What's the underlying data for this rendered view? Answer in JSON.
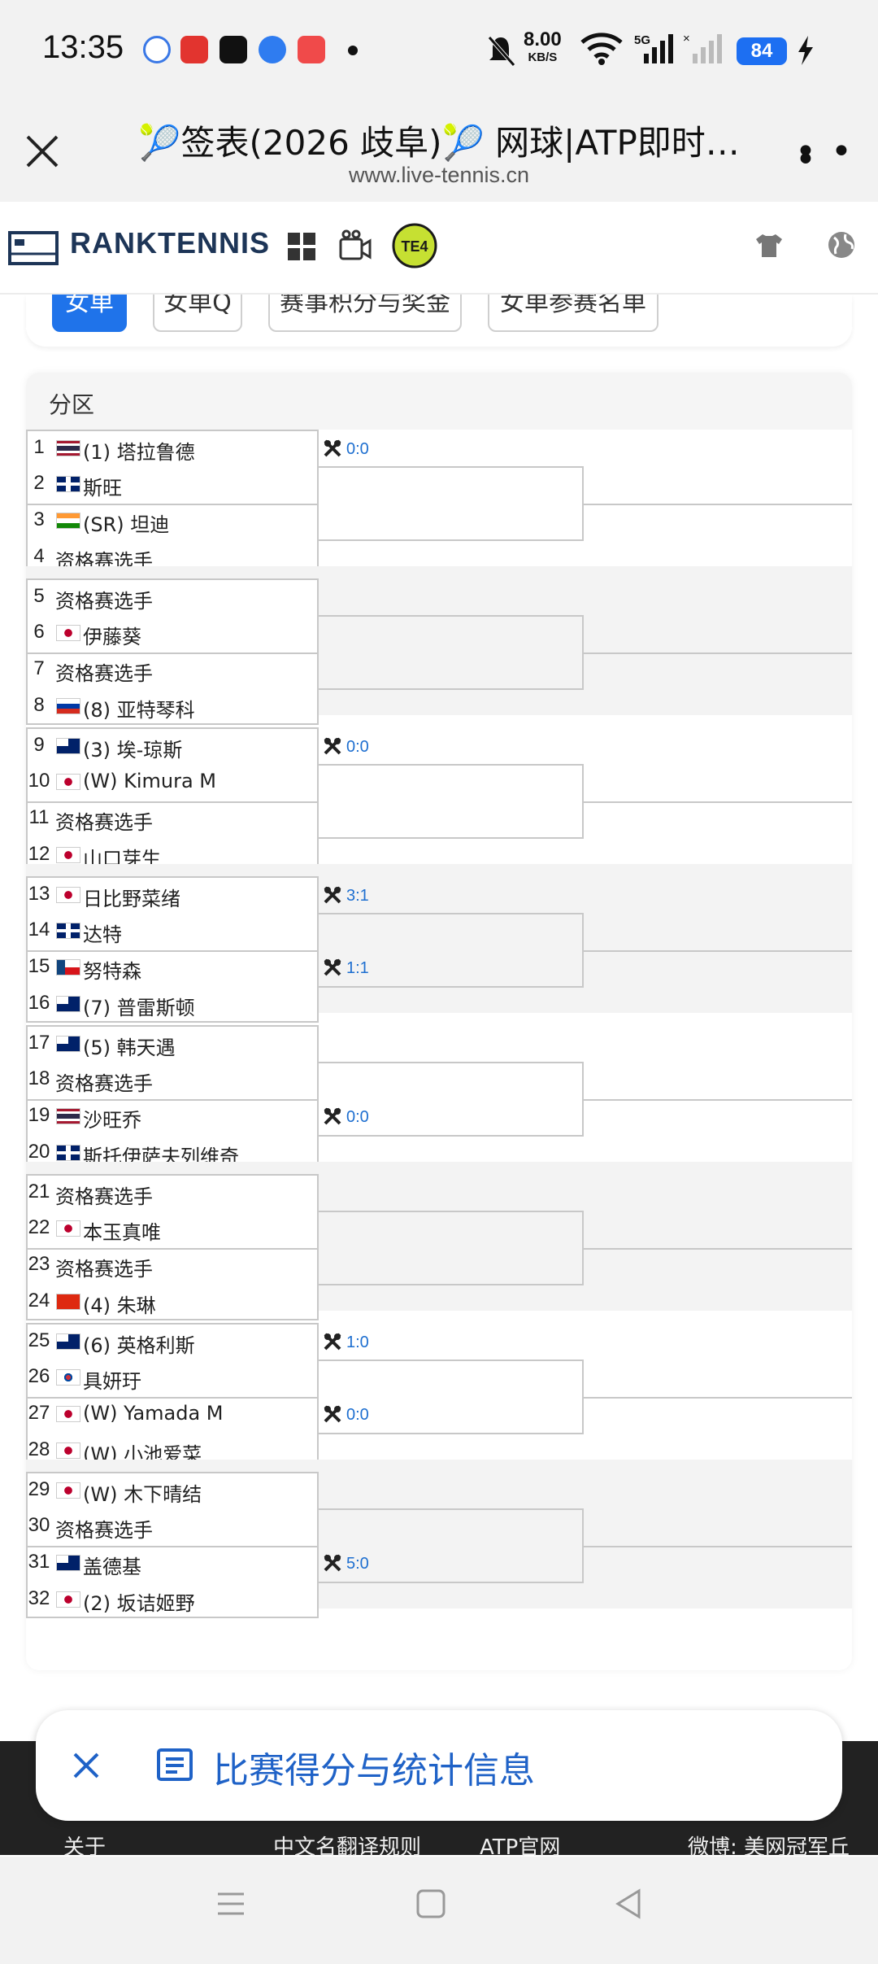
{
  "status": {
    "time": "13:35",
    "net_speed": "8.00",
    "net_unit": "KB/S",
    "battery": "84",
    "signal": "5G"
  },
  "browser": {
    "title": "🎾签表(2026 歧阜)🎾 网球|ATP即时…",
    "url": "www.live-tennis.cn"
  },
  "site": {
    "logo": "RANKTENNIS",
    "badge": "TE4"
  },
  "tabs": [
    {
      "label": "女单",
      "active": true
    },
    {
      "label": "女单Q",
      "active": false
    },
    {
      "label": "赛事积分与奖金",
      "active": false
    },
    {
      "label": "女单参赛名单",
      "active": false
    }
  ],
  "section_title": "分区",
  "players": [
    {
      "num": "1",
      "flag": "th",
      "name": "(1) 塔拉鲁德"
    },
    {
      "num": "2",
      "flag": "gb",
      "name": "斯旺"
    },
    {
      "num": "3",
      "flag": "in",
      "name": "(SR) 坦迪"
    },
    {
      "num": "4",
      "flag": "",
      "name": "资格赛选手"
    },
    {
      "num": "5",
      "flag": "",
      "name": "资格赛选手"
    },
    {
      "num": "6",
      "flag": "jp",
      "name": "伊藤葵"
    },
    {
      "num": "7",
      "flag": "",
      "name": "资格赛选手"
    },
    {
      "num": "8",
      "flag": "ru",
      "name": "(8) 亚特琴科"
    },
    {
      "num": "9",
      "flag": "au",
      "name": "(3) 埃-琼斯"
    },
    {
      "num": "10",
      "flag": "jp",
      "name": "(W) Kimura M"
    },
    {
      "num": "11",
      "flag": "",
      "name": "资格赛选手"
    },
    {
      "num": "12",
      "flag": "jp",
      "name": "山口芽生"
    },
    {
      "num": "13",
      "flag": "jp",
      "name": "日比野菜绪"
    },
    {
      "num": "14",
      "flag": "gb",
      "name": "达特"
    },
    {
      "num": "15",
      "flag": "cz",
      "name": "努特森"
    },
    {
      "num": "16",
      "flag": "au",
      "name": "(7) 普雷斯顿"
    },
    {
      "num": "17",
      "flag": "au",
      "name": "(5) 韩天遇"
    },
    {
      "num": "18",
      "flag": "",
      "name": "资格赛选手"
    },
    {
      "num": "19",
      "flag": "th",
      "name": "沙旺乔"
    },
    {
      "num": "20",
      "flag": "gb",
      "name": "斯托伊萨夫列维奇"
    },
    {
      "num": "21",
      "flag": "",
      "name": "资格赛选手"
    },
    {
      "num": "22",
      "flag": "jp",
      "name": "本玉真唯"
    },
    {
      "num": "23",
      "flag": "",
      "name": "资格赛选手"
    },
    {
      "num": "24",
      "flag": "cn",
      "name": "(4) 朱琳"
    },
    {
      "num": "25",
      "flag": "au",
      "name": "(6) 英格利斯"
    },
    {
      "num": "26",
      "flag": "kr",
      "name": "具妍玗"
    },
    {
      "num": "27",
      "flag": "jp",
      "name": "(W) Yamada M"
    },
    {
      "num": "28",
      "flag": "jp",
      "name": "(W) 小池爱菜"
    },
    {
      "num": "29",
      "flag": "jp",
      "name": "(W) 木下晴结"
    },
    {
      "num": "30",
      "flag": "",
      "name": "资格赛选手"
    },
    {
      "num": "31",
      "flag": "au",
      "name": "盖德基"
    },
    {
      "num": "32",
      "flag": "jp",
      "name": "(2) 坂诘姬野"
    }
  ],
  "scores": [
    {
      "match": 1,
      "text": "0:0"
    },
    {
      "match": 5,
      "text": "0:0"
    },
    {
      "match": 7,
      "text": "3:1"
    },
    {
      "match": 8,
      "text": "1:1"
    },
    {
      "match": 10,
      "text": "0:0"
    },
    {
      "match": 13,
      "text": "1:0"
    },
    {
      "match": 14,
      "text": "0:0"
    },
    {
      "match": 16,
      "text": "5:0"
    }
  ],
  "stat_bar": {
    "label": "比赛得分与统计信息"
  },
  "footer": [
    "关于",
    "中文名翻译规则",
    "ATP官网",
    "微博: 美网冠军丘"
  ],
  "colors": {
    "accent": "#1f73ea",
    "score": "#1e6fd0",
    "border": "#c8c8c8"
  }
}
